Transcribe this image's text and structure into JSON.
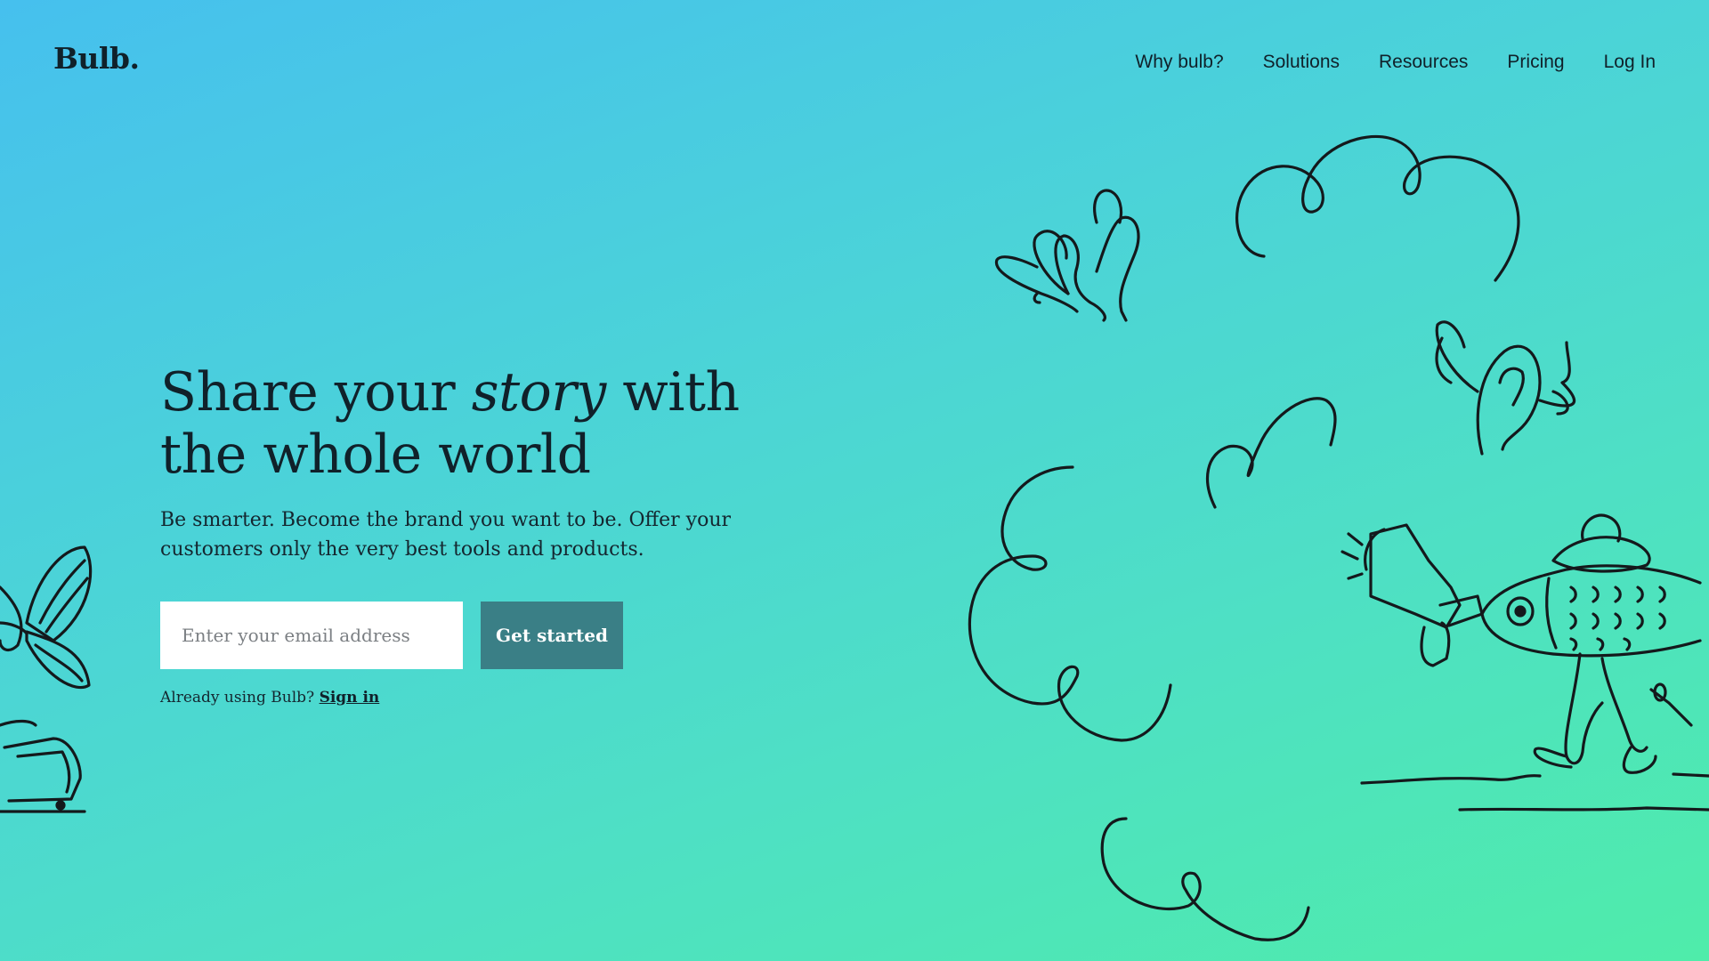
{
  "brand": {
    "logo": "Bulb."
  },
  "nav": {
    "items": [
      {
        "label": "Why bulb?"
      },
      {
        "label": "Solutions"
      },
      {
        "label": "Resources"
      },
      {
        "label": "Pricing"
      },
      {
        "label": "Log In"
      }
    ]
  },
  "hero": {
    "headline_part1": "Share your ",
    "headline_emphasis": "story",
    "headline_part2": " with the whole world",
    "subtitle": "Be smarter. Become the brand you want to be. Offer your customers only the very best tools and products.",
    "email_placeholder": "Enter your email address",
    "cta_label": "Get started",
    "signin_prompt": "Already using Bulb? ",
    "signin_link": "Sign in"
  },
  "illustration": {
    "icons": [
      "butterfly-icon",
      "winged-ear-icon",
      "cloud-doodle-icon",
      "fish-with-megaphone-icon",
      "falling-suitcase-icon"
    ]
  },
  "colors": {
    "gradient_start": "#46c0ee",
    "gradient_end": "#4fecaa",
    "cta_bg": "#3a7f86",
    "text": "#10212a"
  }
}
